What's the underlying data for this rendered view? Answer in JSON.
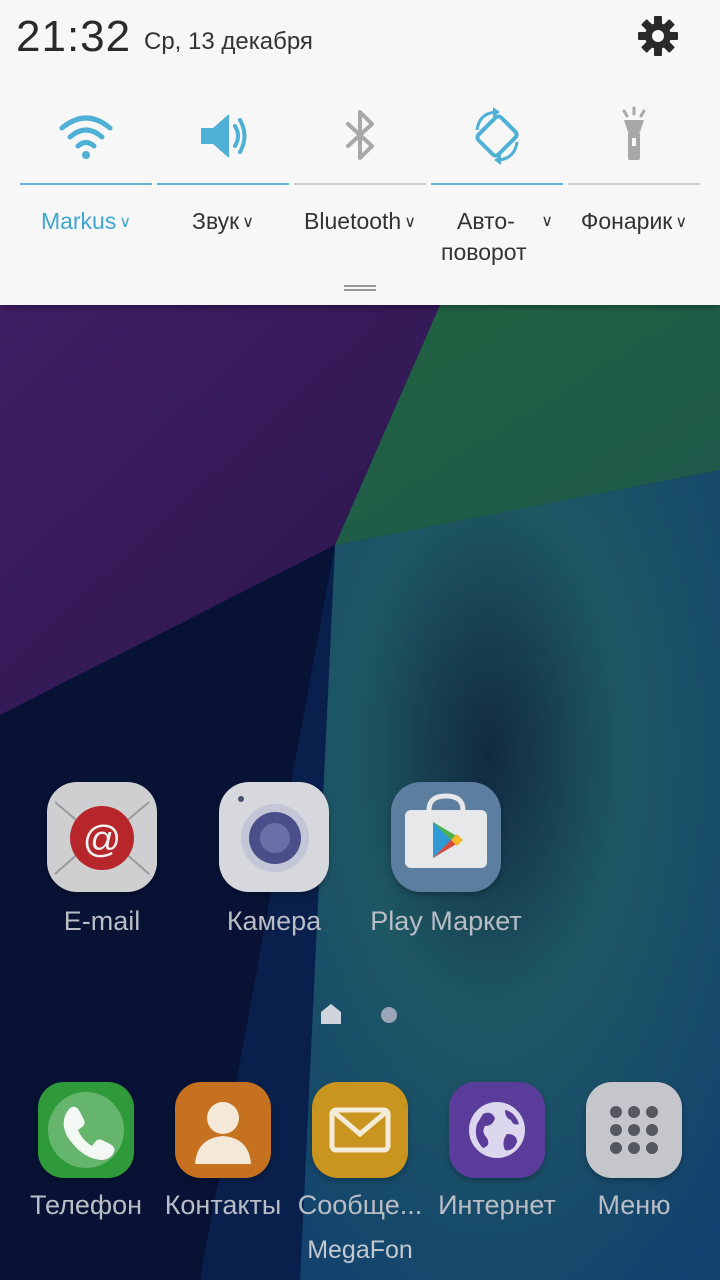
{
  "status": {
    "time": "21:32",
    "date": "Ср, 13 декабря"
  },
  "quick_toggles": [
    {
      "label": "Markus",
      "icon": "wifi-icon",
      "active": true
    },
    {
      "label": "Звук",
      "icon": "volume-icon",
      "active": true
    },
    {
      "label": "Bluetooth",
      "icon": "bluetooth-icon",
      "active": false
    },
    {
      "label_line1": "Авто-",
      "label_line2": "поворот",
      "icon": "auto-rotate-icon",
      "active": true
    },
    {
      "label": "Фонарик",
      "icon": "flashlight-icon",
      "active": false
    }
  ],
  "home_apps": [
    {
      "label": "E-mail",
      "icon": "email-icon"
    },
    {
      "label": "Камера",
      "icon": "camera-icon"
    },
    {
      "label": "Play Маркет",
      "icon": "play-store-icon"
    }
  ],
  "dock_apps": [
    {
      "label": "Телефон",
      "icon": "phone-icon"
    },
    {
      "label": "Контакты",
      "icon": "contacts-icon"
    },
    {
      "label": "Сообще...",
      "icon": "messages-icon"
    },
    {
      "label": "Интернет",
      "icon": "internet-icon"
    },
    {
      "label": "Меню",
      "icon": "apps-menu-icon"
    }
  ],
  "carrier": "MegaFon",
  "colors": {
    "accent": "#3fa6cf",
    "shade_bg": "#f7f7f7"
  }
}
